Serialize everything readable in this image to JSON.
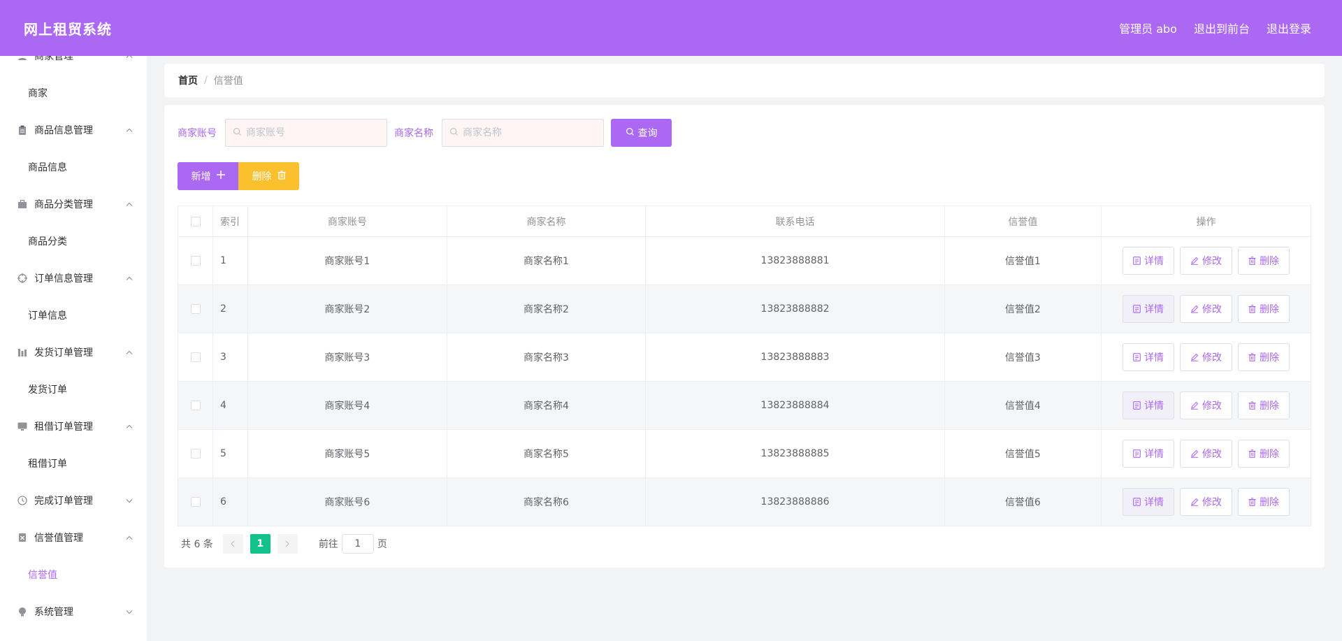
{
  "header": {
    "title": "网上租贸系统",
    "user": "管理员 abo",
    "to_front": "退出到前台",
    "logout": "退出登录"
  },
  "sidebar": {
    "groups": [
      {
        "title": "商家管理",
        "icon": "user-icon",
        "expanded": true,
        "children": [
          "商家"
        ]
      },
      {
        "title": "商品信息管理",
        "icon": "clipboard-icon",
        "expanded": true,
        "children": [
          "商品信息"
        ]
      },
      {
        "title": "商品分类管理",
        "icon": "briefcase-icon",
        "expanded": true,
        "children": [
          "商品分类"
        ]
      },
      {
        "title": "订单信息管理",
        "icon": "target-icon",
        "expanded": true,
        "children": [
          "订单信息"
        ]
      },
      {
        "title": "发货订单管理",
        "icon": "bars-icon",
        "expanded": true,
        "children": [
          "发货订单"
        ]
      },
      {
        "title": "租借订单管理",
        "icon": "monitor-icon",
        "expanded": true,
        "children": [
          "租借订单"
        ]
      },
      {
        "title": "完成订单管理",
        "icon": "clock-icon",
        "expanded": false,
        "children": []
      },
      {
        "title": "信誉值管理",
        "icon": "badge-icon",
        "expanded": true,
        "children": [
          "信誉值"
        ]
      },
      {
        "title": "系统管理",
        "icon": "bulb-icon",
        "expanded": false,
        "children": []
      }
    ],
    "active_item": "信誉值"
  },
  "breadcrumb": {
    "home": "首页",
    "separator": "/",
    "current": "信誉值"
  },
  "search": {
    "account_label": "商家账号",
    "account_placeholder": "商家账号",
    "name_label": "商家名称",
    "name_placeholder": "商家名称",
    "query_label": "查询"
  },
  "actions": {
    "add_label": "新增",
    "delete_label": "删除"
  },
  "table": {
    "headers": [
      "索引",
      "商家账号",
      "商家名称",
      "联系电话",
      "信誉值",
      "操作"
    ],
    "rows": [
      {
        "index": "1",
        "account": "商家账号1",
        "name": "商家名称1",
        "phone": "13823888881",
        "credit": "信誉值1"
      },
      {
        "index": "2",
        "account": "商家账号2",
        "name": "商家名称2",
        "phone": "13823888882",
        "credit": "信誉值2"
      },
      {
        "index": "3",
        "account": "商家账号3",
        "name": "商家名称3",
        "phone": "13823888883",
        "credit": "信誉值3"
      },
      {
        "index": "4",
        "account": "商家账号4",
        "name": "商家名称4",
        "phone": "13823888884",
        "credit": "信誉值4"
      },
      {
        "index": "5",
        "account": "商家账号5",
        "name": "商家名称5",
        "phone": "13823888885",
        "credit": "信誉值5"
      },
      {
        "index": "6",
        "account": "商家账号6",
        "name": "商家名称6",
        "phone": "13823888886",
        "credit": "信誉值6"
      }
    ],
    "row_actions": {
      "detail": "详情",
      "edit": "修改",
      "delete": "删除"
    }
  },
  "pagination": {
    "total": "共 6 条",
    "current_page": "1",
    "goto_label": "前往",
    "goto_value": "1",
    "goto_suffix": "页"
  },
  "colors": {
    "primary": "#ab68f3",
    "warning": "#fbc02d",
    "page_active": "#13c28a"
  }
}
